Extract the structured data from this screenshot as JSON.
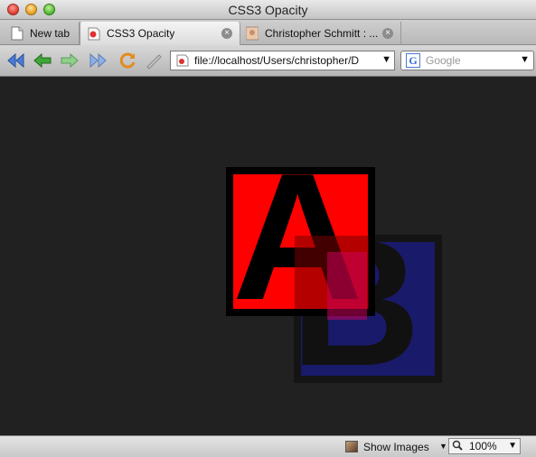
{
  "window": {
    "title": "CSS3 Opacity"
  },
  "tabs": [
    {
      "label": "New tab"
    },
    {
      "label": "CSS3 Opacity"
    },
    {
      "label": "Christopher Schmitt : ..."
    }
  ],
  "toolbar": {
    "url": "file://localhost/Users/christopher/D",
    "search_placeholder": "Google",
    "search_engine_letter": "G"
  },
  "content": {
    "box_a_letter": "A",
    "box_b_letter": "B",
    "box_a_color": "#ff0000",
    "box_b_color": "#1a1a6b"
  },
  "statusbar": {
    "show_images_label": "Show Images",
    "zoom": "100%"
  }
}
